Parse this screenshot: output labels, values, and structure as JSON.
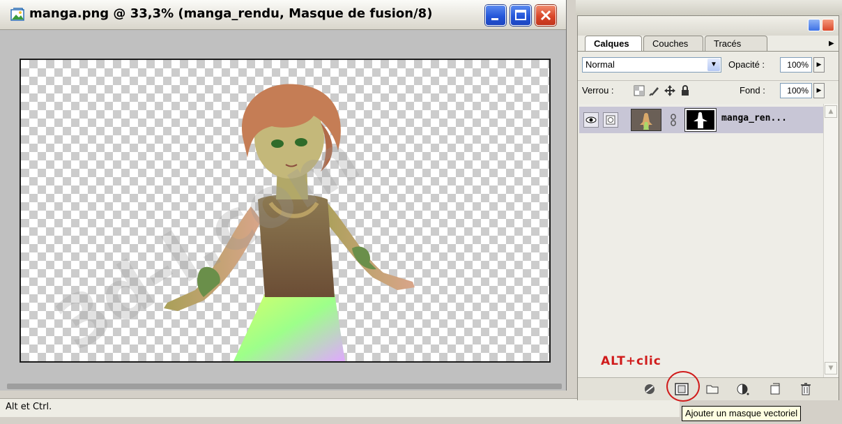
{
  "document": {
    "title": "manga.png @ 33,3% (manga_rendu, Masque de fusion/8)",
    "watermark": "3d-l.com"
  },
  "status_bar": {
    "text": "Alt et Ctrl."
  },
  "layers_panel": {
    "tabs": [
      {
        "label": "Calques",
        "active": true
      },
      {
        "label": "Couches",
        "active": false
      },
      {
        "label": "Tracés",
        "active": false
      }
    ],
    "blend_mode": "Normal",
    "opacity_label": "Opacité :",
    "opacity_value": "100%",
    "lock_label": "Verrou :",
    "fill_label": "Fond :",
    "fill_value": "100%",
    "layers": [
      {
        "name": "manga_ren...",
        "visible": true,
        "has_mask": true
      }
    ],
    "bottom_buttons": [
      "link-layers-icon",
      "add-vector-mask-icon",
      "new-group-icon",
      "adjustment-layer-icon",
      "new-layer-icon",
      "trash-icon"
    ]
  },
  "annotation": {
    "label": "ALT+clic",
    "color": "#d01b1b"
  },
  "tooltip": {
    "text": "Ajouter un masque vectoriel"
  }
}
